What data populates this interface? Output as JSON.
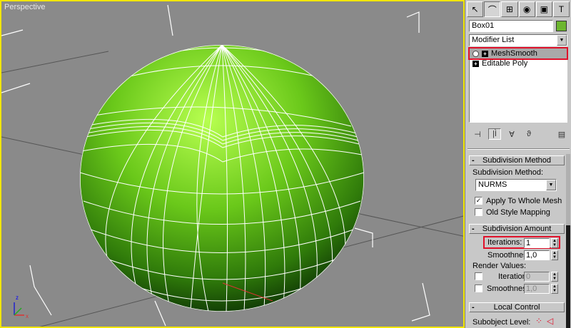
{
  "viewport": {
    "label": "Perspective"
  },
  "panel": {
    "tabs": [
      {
        "name": "create-tab",
        "glyph": "↖"
      },
      {
        "name": "modify-tab",
        "glyph": "⌒"
      },
      {
        "name": "hierarchy-tab",
        "glyph": "⊞"
      },
      {
        "name": "motion-tab",
        "glyph": "◉"
      },
      {
        "name": "display-tab",
        "glyph": "▣"
      },
      {
        "name": "utilities-tab",
        "glyph": "T"
      }
    ],
    "object_name": "Box01",
    "object_color": "#6cb62e",
    "modifier_list": "Modifier List",
    "stack": {
      "items": [
        {
          "label": "MeshSmooth",
          "selected": true
        },
        {
          "label": "Editable Poly",
          "selected": false
        }
      ]
    },
    "stack_tools": [
      "pin-stack",
      "show-end-result",
      "make-unique",
      "remove-modifier",
      "configure-sets"
    ]
  },
  "subdivision_method": {
    "header": "Subdivision Method",
    "method_label": "Subdivision Method:",
    "method_value": "NURMS",
    "apply_whole_mesh": "Apply To Whole Mesh",
    "apply_whole_mesh_checked": true,
    "old_style": "Old Style Mapping",
    "old_style_checked": false
  },
  "subdivision_amount": {
    "header": "Subdivision Amount",
    "iterations_label": "Iterations:",
    "iterations_value": "1",
    "smoothness_label": "Smoothness:",
    "smoothness_value": "1,0",
    "render_values_label": "Render Values:",
    "render_iterations_label": "Iterations:",
    "render_iterations_value": "0",
    "render_smoothness_label": "Smoothness:",
    "render_smoothness_value": "1,0"
  },
  "local_control": {
    "header": "Local Control",
    "subobject_label": "Subobject Level:"
  },
  "colors": {
    "viewport_border": "#f2e600",
    "highlight": "#e0102a",
    "sphere_green": "#6cb62e"
  }
}
